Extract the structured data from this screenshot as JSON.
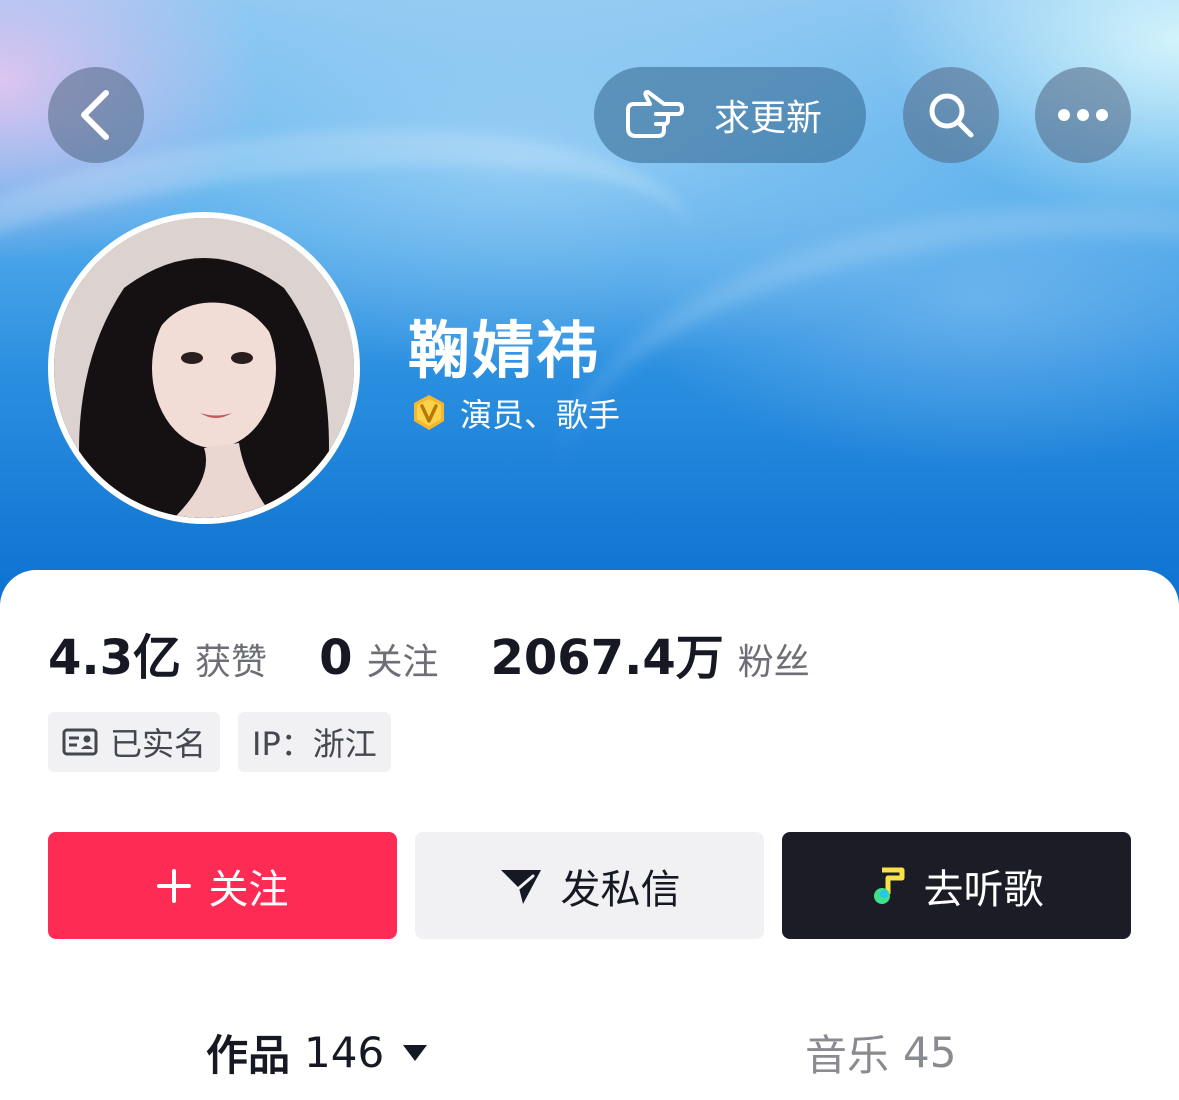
{
  "header": {
    "update_label": "求更新"
  },
  "profile": {
    "name": "鞠婧祎",
    "verify_text": "演员、歌手"
  },
  "stats": [
    {
      "value": "4.3亿",
      "label": "获赞"
    },
    {
      "value": "0",
      "label": "关注"
    },
    {
      "value": "2067.4万",
      "label": "粉丝"
    }
  ],
  "tags": {
    "realname": "已实名",
    "ip": "IP：浙江"
  },
  "actions": {
    "follow": "关注",
    "message": "发私信",
    "music": "去听歌"
  },
  "tabs": {
    "works_label": "作品",
    "works_count": "146",
    "music_label": "音乐",
    "music_count": "45"
  },
  "colors": {
    "follow_button": "#fe2c55",
    "music_button": "#1b1c25",
    "verify_badge": "#f5b731"
  },
  "icons": [
    "back-icon",
    "pointing-hand-icon",
    "search-icon",
    "more-icon",
    "verified-badge-icon",
    "id-card-icon",
    "plus-icon",
    "send-icon",
    "music-note-icon",
    "caret-down-icon"
  ]
}
